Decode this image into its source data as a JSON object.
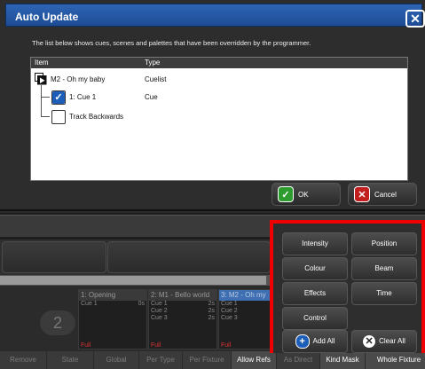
{
  "dialog": {
    "title": "Auto Update",
    "description": "The list below shows cues, scenes and palettes that have been overridden by the programmer.",
    "columns": {
      "item": "Item",
      "type": "Type"
    },
    "rows": [
      {
        "item": "M2 - Oh my baby",
        "type": "Cuelist"
      },
      {
        "item": "1: Cue 1",
        "type": "Cue"
      },
      {
        "item": "Track Backwards",
        "type": ""
      }
    ],
    "ok_label": "OK",
    "cancel_label": "Cancel"
  },
  "kind_mask": {
    "intensity": "Intensity",
    "position": "Position",
    "colour": "Colour",
    "beam": "Beam",
    "effects": "Effects",
    "time": "Time",
    "control": "Control",
    "add_all": "Add All",
    "clear_all": "Clear All"
  },
  "background": {
    "big_number": "2",
    "cuelists": [
      {
        "header": "1: Opening",
        "cues": [
          {
            "name": "Cue 1",
            "time": "0s"
          }
        ],
        "state": "Full"
      },
      {
        "header": "2: M1 - Bello world",
        "cues": [
          {
            "name": "Cue 1",
            "time": "2s"
          },
          {
            "name": "Cue 2",
            "time": "2s"
          },
          {
            "name": "Cue 3",
            "time": "2s"
          }
        ],
        "state": "Full"
      },
      {
        "header": "3: M2 - Oh my",
        "cues": [
          {
            "name": "Cue 1",
            "time": ""
          },
          {
            "name": "Cue 2",
            "time": ""
          },
          {
            "name": "Cue 3",
            "time": ""
          }
        ],
        "state": "Full"
      }
    ],
    "bottom_buttons": [
      "Remove",
      "State",
      "Global",
      "Per Type",
      "Per Fixture",
      "Allow Refs",
      "As Direct",
      "Kind Mask",
      "Whole Fixture"
    ],
    "active_bottom_buttons": [
      "Allow Refs",
      "Kind Mask",
      "Whole Fixture"
    ]
  },
  "colors": {
    "dialog_title_bar": "#1d4c94",
    "highlight": "#e00000",
    "ok_icon": "#2e9b2e",
    "cancel_icon": "#c21f1f"
  }
}
